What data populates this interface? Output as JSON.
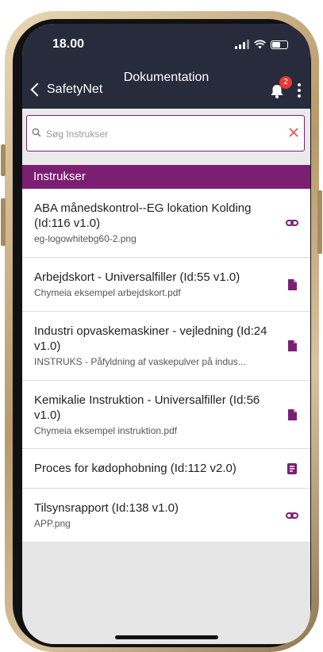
{
  "status": {
    "time": "18.00"
  },
  "header": {
    "title": "Dokumentation",
    "back_label": "SafetyNet",
    "notification_count": "2"
  },
  "search": {
    "placeholder": "Søg Instrukser",
    "value": ""
  },
  "section": {
    "title": "Instrukser"
  },
  "items": [
    {
      "title": "ABA månedskontrol--EG lokation Kolding (Id:116 v1.0)",
      "subtitle": "eg-logowhitebg60-2.png",
      "icon": "link-icon"
    },
    {
      "title": "Arbejdskort - Universalfiller (Id:55 v1.0)",
      "subtitle": "Chymeia eksempel arbejdskort.pdf",
      "icon": "file-icon"
    },
    {
      "title": "Industri opvaskemaskiner - vejledning (Id:24 v1.0)",
      "subtitle": "INSTRUKS - Påfyldning af vaskepulver på indus...",
      "icon": "file-icon"
    },
    {
      "title": "Kemikalie Instruktion - Universalfiller (Id:56 v1.0)",
      "subtitle": "Chymeia eksempel instruktion.pdf",
      "icon": "file-icon"
    },
    {
      "title": "Proces for kødophobning (Id:112 v2.0)",
      "subtitle": "",
      "icon": "document-lines-icon"
    },
    {
      "title": "Tilsynsrapport (Id:138 v1.0)",
      "subtitle": "APP.png",
      "icon": "link-icon"
    }
  ],
  "colors": {
    "header_bg": "#272b3c",
    "accent_purple": "#7b1f72",
    "badge_red": "#e53935",
    "clear_red": "#d9534f"
  }
}
